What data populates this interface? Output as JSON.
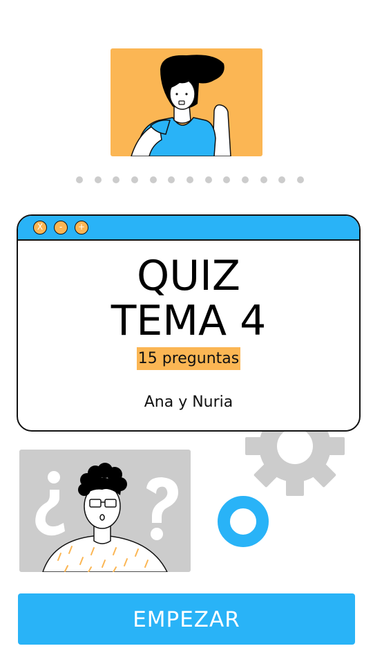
{
  "header": {
    "illustration": "person-waving-icon",
    "progress_dots_count": 13
  },
  "card": {
    "window_buttons": [
      "X",
      "-",
      "+"
    ],
    "title_line1": "QUIZ",
    "title_line2": "TEMA 4",
    "subtitle": "15 preguntas",
    "authors": "Ana y Nuria"
  },
  "decorations": {
    "bottom_illustration": "thinking-person-question-marks-icon",
    "gear": "gear-icon",
    "ring": "ring-icon"
  },
  "actions": {
    "start_label": "EMPEZAR"
  },
  "colors": {
    "accent_blue": "#29b3f7",
    "accent_orange": "#fbb654",
    "gray": "#cccccc"
  }
}
